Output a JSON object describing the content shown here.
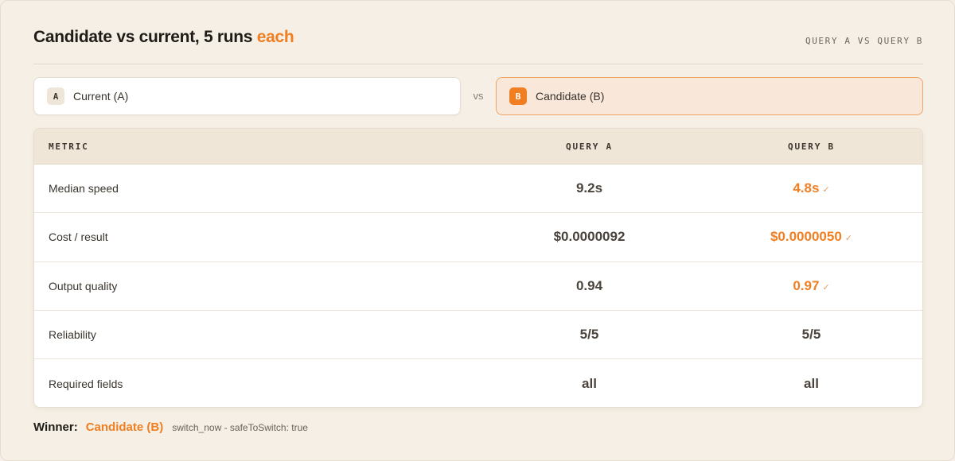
{
  "header": {
    "title_main": "Candidate vs current, 5 runs ",
    "title_accent": "each",
    "subtitle": "QUERY A VS QUERY B"
  },
  "pickers": {
    "a": {
      "badge": "A",
      "label": "Current (A)"
    },
    "vs": "vs",
    "b": {
      "badge": "B",
      "label": "Candidate (B)"
    }
  },
  "table": {
    "columns": [
      "METRIC",
      "QUERY A",
      "QUERY B"
    ],
    "rows": [
      {
        "metric": "Median speed",
        "a": "9.2s",
        "b": "4.8s",
        "b_check": "✓"
      },
      {
        "metric": "Cost / result",
        "a": "$0.0000092",
        "b": "$0.0000050",
        "b_check": "✓"
      },
      {
        "metric": "Output quality",
        "a": "0.94",
        "b": "0.97",
        "b_check": "✓"
      },
      {
        "metric": "Reliability",
        "a": "5/5",
        "b": "5/5"
      },
      {
        "metric": "Required fields",
        "a": "all",
        "b": "all"
      }
    ]
  },
  "footer": {
    "winner_label": "Winner:",
    "winner_value": "Candidate (B)",
    "meta": "switch_now - safeToSwitch: true"
  },
  "colors": {
    "accent": "#ef7f22",
    "background": "#f5efe5",
    "header_row": "#efe6d8"
  },
  "icons": {
    "check": "check-icon"
  }
}
